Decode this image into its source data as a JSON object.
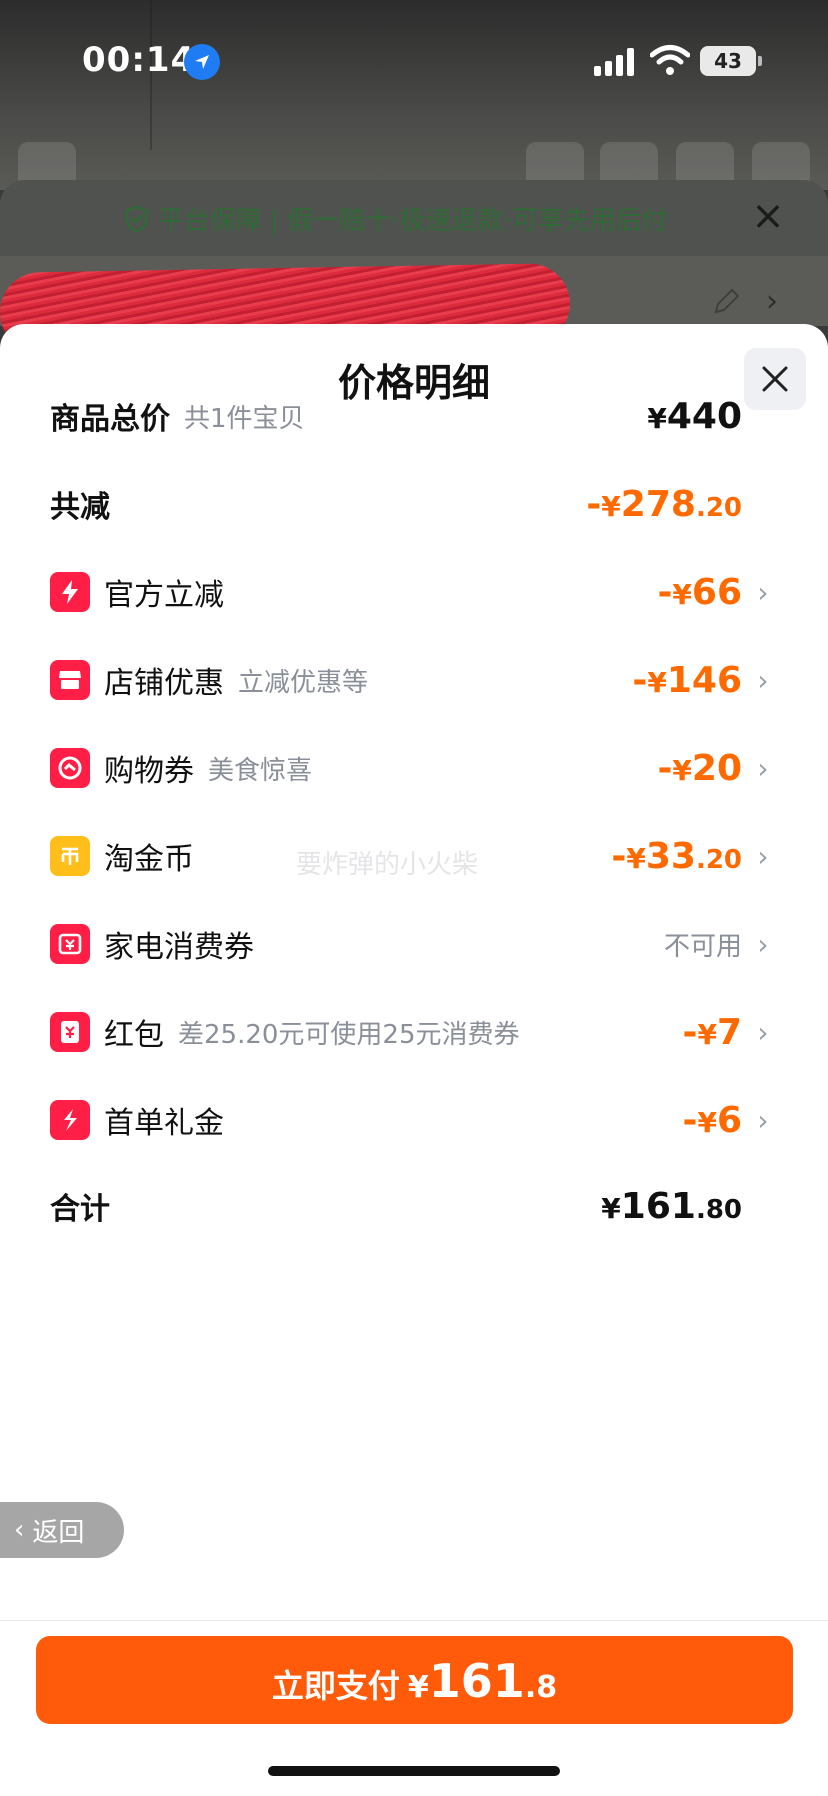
{
  "status_bar": {
    "time": "00:14",
    "battery": "43"
  },
  "banner": {
    "text": "平台保障 | 假一赔十·极速退款·可享先用后付",
    "color": "#2f6b35"
  },
  "sheet": {
    "title": "价格明细",
    "rows": [
      {
        "label": "商品总价",
        "sub": "共1件宝贝",
        "sign": "",
        "yen": "¥",
        "int": "440",
        "cents": "",
        "style": "black"
      },
      {
        "label": "共减",
        "sub": "",
        "sign": "-",
        "yen": "¥",
        "int": "278",
        "cents": ".20",
        "style": "orange"
      },
      {
        "label": "官方立减",
        "sub": "",
        "sign": "-",
        "yen": "¥",
        "int": "66",
        "cents": "",
        "style": "orange",
        "icon": "lightning-icon"
      },
      {
        "label": "店铺优惠",
        "sub": "立减优惠等",
        "sign": "-",
        "yen": "¥",
        "int": "146",
        "cents": "",
        "style": "orange",
        "icon": "store-icon"
      },
      {
        "label": "购物券",
        "sub": "美食惊喜",
        "sign": "-",
        "yen": "¥",
        "int": "20",
        "cents": "",
        "style": "orange",
        "icon": "coupon-icon"
      },
      {
        "label": "淘金币",
        "sub": "",
        "sign": "-",
        "yen": "¥",
        "int": "33",
        "cents": ".20",
        "style": "orange",
        "icon": "coin-icon"
      },
      {
        "label": "家电消费券",
        "sub": "",
        "status": "不可用",
        "style": "gray",
        "icon": "appliance-coupon-icon"
      },
      {
        "label": "红包",
        "sub": "差25.20元可使用25元消费券",
        "sign": "-",
        "yen": "¥",
        "int": "7",
        "cents": "",
        "style": "orange",
        "icon": "red-envelope-icon"
      },
      {
        "label": "首单礼金",
        "sub": "",
        "sign": "-",
        "yen": "¥",
        "int": "6",
        "cents": "",
        "style": "orange",
        "icon": "first-order-gift-icon"
      },
      {
        "label": "合计",
        "sub": "",
        "sign": "",
        "yen": "¥",
        "int": "161",
        "cents": ".80",
        "style": "black"
      }
    ],
    "watermark": "要炸弹的小火柴"
  },
  "back_label": "返回",
  "pay": {
    "text": "立即支付",
    "yen": "¥",
    "int": "161",
    "cents": ".8"
  },
  "colors": {
    "accent": "#ff5b0a",
    "discount": "#ff6a00",
    "icon_red": "#ff1f46",
    "icon_yellow": "#ffbe1a"
  }
}
